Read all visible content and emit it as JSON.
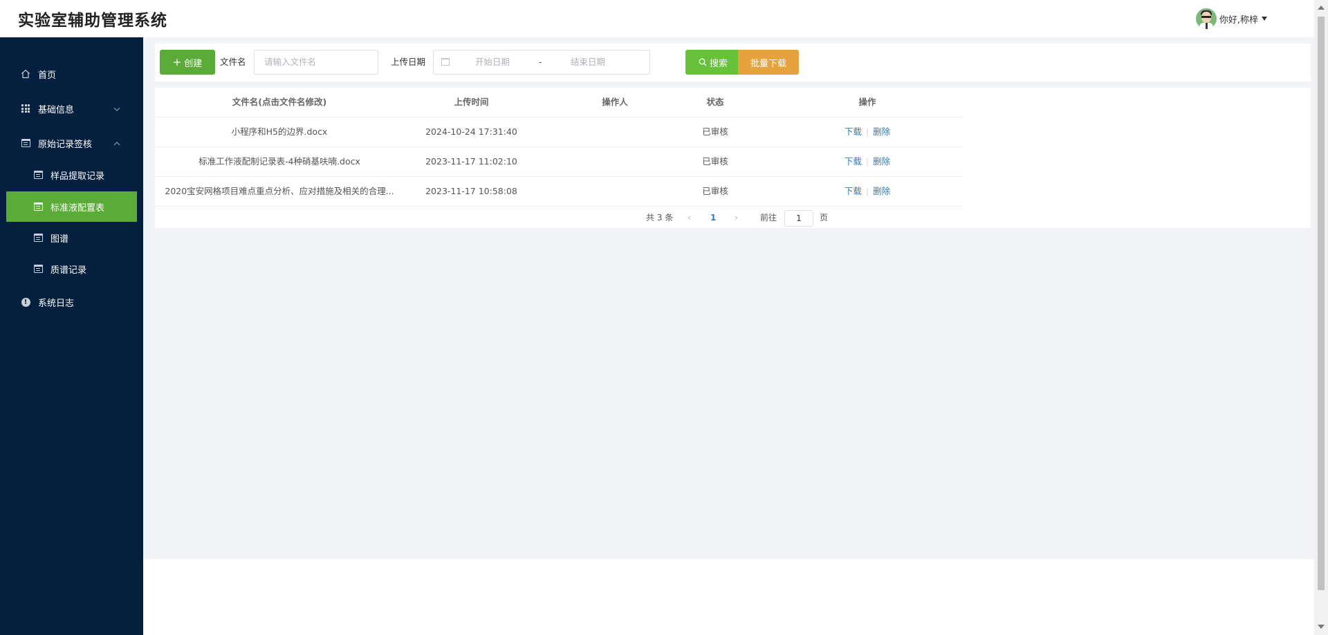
{
  "header": {
    "title": "实验室辅助管理系统",
    "user_greeting": "你好,称梓"
  },
  "sidebar": {
    "items": [
      {
        "label": "首页",
        "icon": "home-icon"
      },
      {
        "label": "基础信息",
        "icon": "grid-icon",
        "expanded": false
      },
      {
        "label": "原始记录签核",
        "icon": "calendar-icon",
        "expanded": true
      },
      {
        "label": "样品提取记录",
        "icon": "calendar-icon"
      },
      {
        "label": "标准液配置表",
        "icon": "calendar-icon",
        "active": true
      },
      {
        "label": "图谱",
        "icon": "calendar-icon"
      },
      {
        "label": "质谱记录",
        "icon": "calendar-icon"
      },
      {
        "label": "系统日志",
        "icon": "warning-icon"
      }
    ]
  },
  "toolbar": {
    "create_label": "创建",
    "filename_label": "文件名",
    "filename_placeholder": "请输入文件名",
    "date_label": "上传日期",
    "start_placeholder": "开始日期",
    "range_separator": "-",
    "end_placeholder": "结束日期",
    "search_label": "搜索",
    "batch_download_label": "批量下载"
  },
  "table": {
    "headers": [
      "文件名(点击文件名修改)",
      "上传时间",
      "操作人",
      "状态",
      "操作"
    ],
    "rows": [
      {
        "name": "小程序和H5的边界.docx",
        "time": "2024-10-24 17:31:40",
        "operator": "",
        "status": "已审核"
      },
      {
        "name": "标准工作液配制记录表-4种硝基呋喃.docx",
        "time": "2023-11-17 11:02:10",
        "operator": "",
        "status": "已审核"
      },
      {
        "name": "2020宝安网格项目难点重点分析、应对措施及相关的合理...",
        "time": "2023-11-17 10:58:08",
        "operator": "",
        "status": "已审核"
      }
    ],
    "action_download": "下载",
    "action_delete": "删除"
  },
  "pagination": {
    "total_text": "共 3 条",
    "current_page": "1",
    "goto_label": "前往",
    "goto_value": "1",
    "page_suffix": "页"
  },
  "colors": {
    "sidebar_bg": "#05203e",
    "active_green": "#5aab37",
    "search_green": "#67c23a",
    "batch_orange": "#e6a23c",
    "link_blue": "#2f7bbd"
  }
}
